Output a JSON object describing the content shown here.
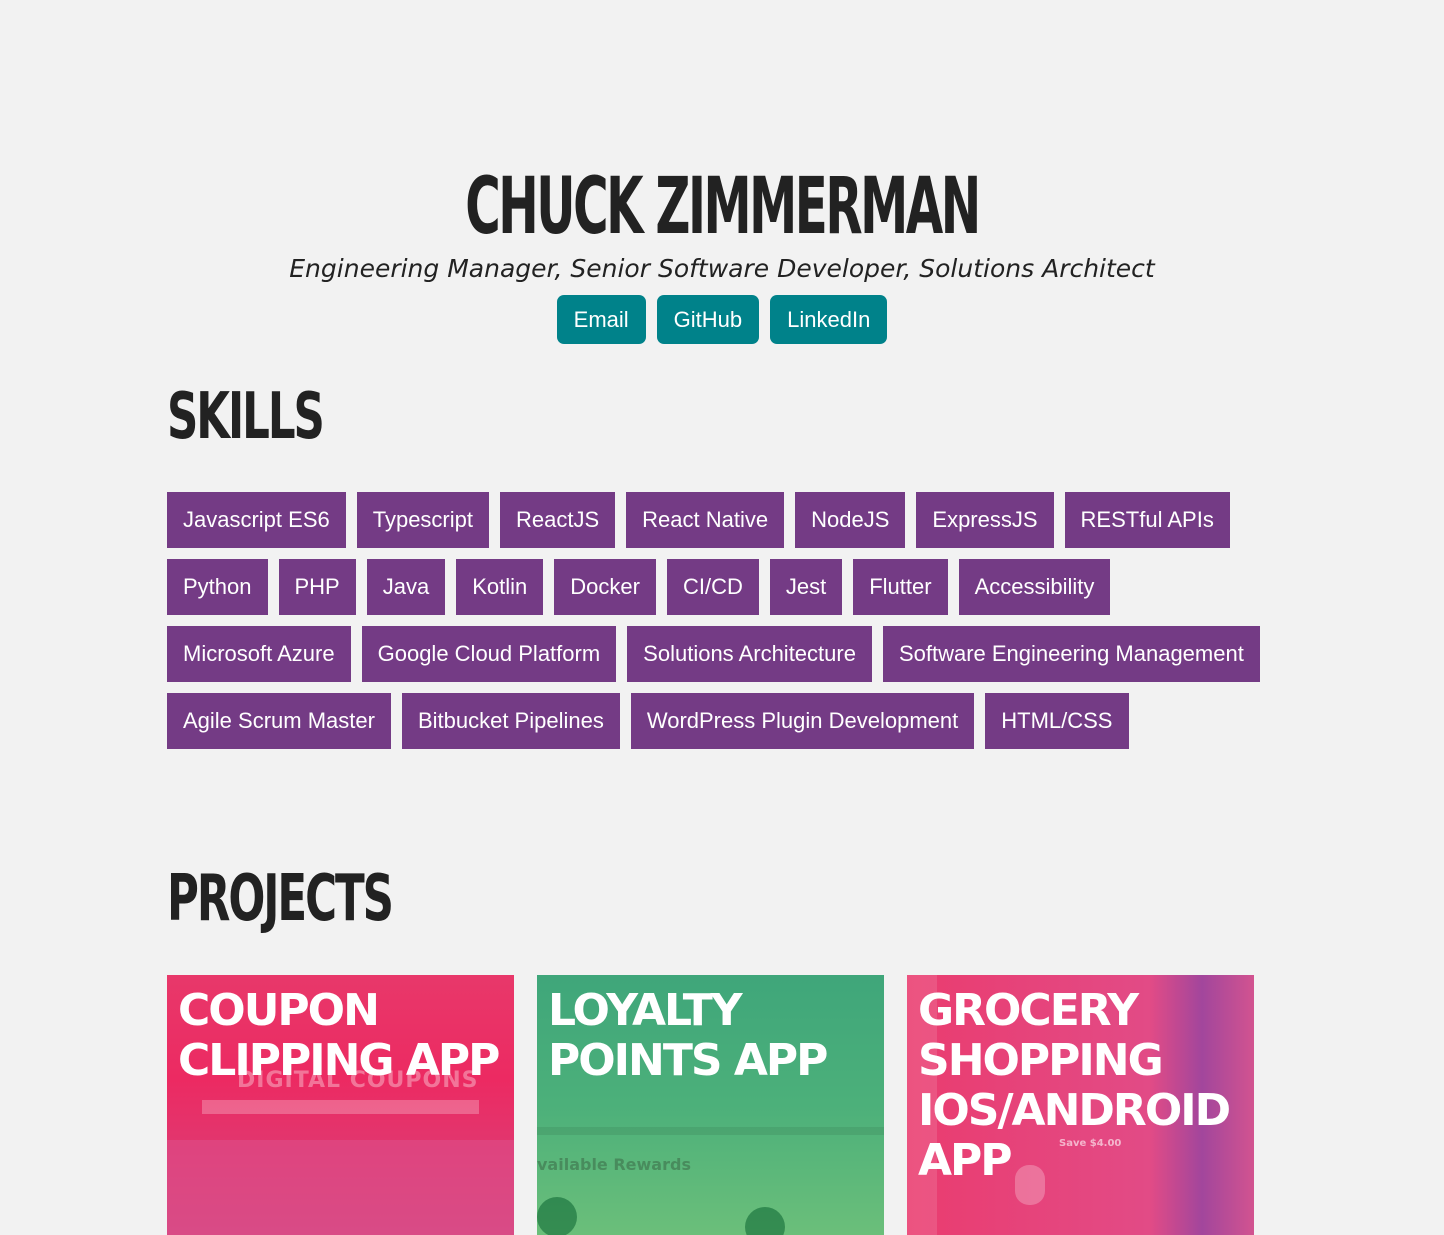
{
  "header": {
    "name": "CHUCK ZIMMERMAN",
    "tagline": "Engineering Manager, Senior Software Developer, Solutions Architect",
    "links": [
      {
        "label": "Email"
      },
      {
        "label": "GitHub"
      },
      {
        "label": "LinkedIn"
      }
    ]
  },
  "skills": {
    "title": "SKILLS",
    "items": [
      "Javascript ES6",
      "Typescript",
      "ReactJS",
      "React Native",
      "NodeJS",
      "ExpressJS",
      "RESTful APIs",
      "Python",
      "PHP",
      "Java",
      "Kotlin",
      "Docker",
      "CI/CD",
      "Jest",
      "Flutter",
      "Accessibility",
      "Microsoft Azure",
      "Google Cloud Platform",
      "Solutions Architecture",
      "Software Engineering Management",
      "Agile Scrum Master",
      "Bitbucket Pipelines",
      "WordPress Plugin Development",
      "HTML/CSS"
    ]
  },
  "projects": {
    "title": "PROJECTS",
    "items": [
      {
        "title": "COUPON CLIPPING APP",
        "screenshot_text": "DIGITAL COUPONS"
      },
      {
        "title": "LOYALTY POINTS APP",
        "screenshot_text": "vailable Rewards"
      },
      {
        "title": "GROCERY SHOPPING IOS/ANDROID APP",
        "screenshot_text": "Save $4.00"
      }
    ]
  },
  "colors": {
    "background": "#f2f2f2",
    "contact_button": "#00828a",
    "skill_tag": "#743b85",
    "text": "#222222"
  }
}
